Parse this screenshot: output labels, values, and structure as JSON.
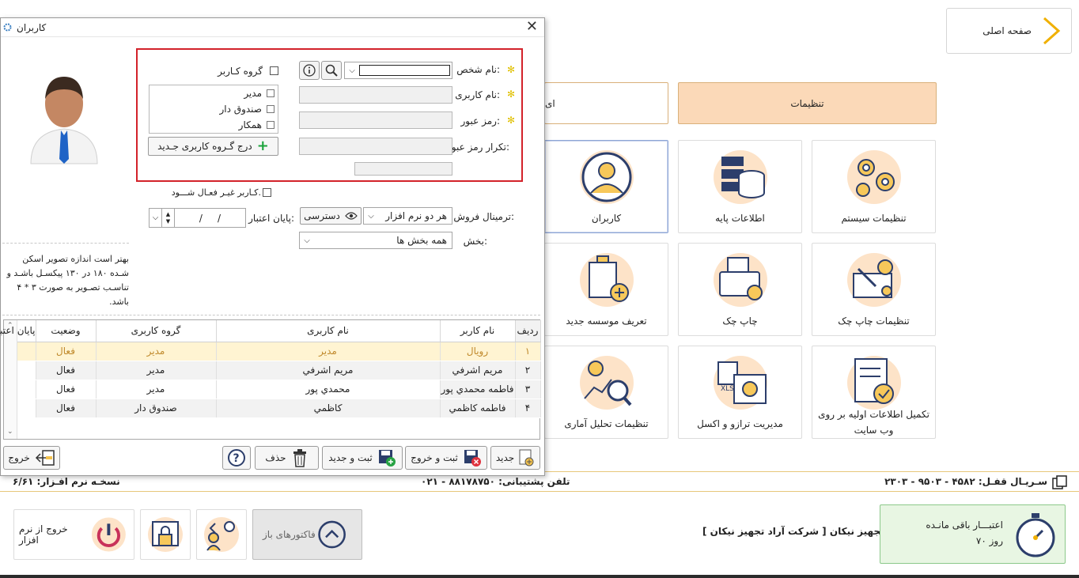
{
  "background": {
    "home_label": "صفحه اصلی",
    "tab_settings": "تنظیمات",
    "tab_other": "ای",
    "tiles": {
      "system_settings": "تنظیمات سیستم",
      "base_info": "اطلاعات پایه",
      "users": "کاربران",
      "cheque_print_settings": "تنظیمات چاپ چک",
      "print_cheque": "چاپ چک",
      "new_company": "تعریف موسسه جدید",
      "complete_info_l1": "تکمیل اطلاعات اولیه بر روی",
      "complete_info_l2": "وب سایت",
      "scale_excel": "مدیریت ترازو و اکسل",
      "stats_settings": "تنظیمات تحلیل آماری"
    },
    "status": {
      "serial": "سـریـال قفـل: ۴۵۸۲ - ۹۵۰۳ - ۲۳۰۳",
      "phone": "تلفن پشتیبانی: ۸۸۱۷۸۷۵۰ - ۰۲۱",
      "version": "نسخـه نرم افـزار: ۶/۶۱"
    },
    "bottom": {
      "exit_label": "خروج از نرم افزار",
      "open_invoices": "فاکتورهای باز",
      "company": "آراد تجهیز نیکان [ شرکت آراد تجهیز نیکان ]",
      "credit_title": "اعتبـــار باقی مانـده",
      "credit_value": "۷۰ روز"
    },
    "colors": {
      "accent_orange": "#fbd9b8",
      "credit_green": "#e8f6e3",
      "red_frame": "#d3222a"
    }
  },
  "dialog": {
    "title": "کاربران",
    "form": {
      "person_name_label": "نام شخص:",
      "username_label": "نام کاربری:",
      "password_label": "رمز عبور:",
      "repeat_password_label": "تکرار رمز عبور:",
      "user_group_label": "گروه کـاربر",
      "groups": [
        "مدیر",
        "صندوق دار",
        "همکار"
      ],
      "add_group_button": "درج گـروه کاربری جـدید",
      "inactive_label": "کـاربر غیـر فعـال شـــود.",
      "terminal_label": "ترمینال فروش:",
      "terminal_value": "هر دو نرم افزار",
      "access_button": "دسترسی",
      "expiry_label": "پایان اعتبار:",
      "expiry_value": "/     /",
      "section_label": "بخش:",
      "section_value": "همه بخش ها"
    },
    "photo_hint": "بهتر است اندازه تصویر اسکن شـده ۱۸۰ در ۱۳۰ پیکسـل باشـد و تناسـب تصـویر به صورت ۳ * ۴ باشد.",
    "table": {
      "headers": {
        "row": "ردیف",
        "name": "نام کاربر",
        "username": "نام کاربری",
        "group": "گروه کاربری",
        "status": "وضعیت",
        "expiry": "پایان اعتبار"
      },
      "rows": [
        {
          "row": "۱",
          "name": "رویال",
          "username": "مدیر",
          "group": "مدیر",
          "status": "فعال",
          "expiry": ""
        },
        {
          "row": "۲",
          "name": "مریم اشرفي",
          "username": "مریم اشرفي",
          "group": "مدیر",
          "status": "فعال",
          "expiry": ""
        },
        {
          "row": "۳",
          "name": "فاطمه محمدي پور",
          "username": "محمدي پور",
          "group": "مدیر",
          "status": "فعال",
          "expiry": ""
        },
        {
          "row": "۴",
          "name": "فاطمه کاظمي",
          "username": "کاظمي",
          "group": "صندوق دار",
          "status": "فعال",
          "expiry": ""
        }
      ]
    },
    "buttons": {
      "new": "جدید",
      "save_exit": "ثبت و خروج",
      "save_new": "ثبت و جدید",
      "delete": "حذف",
      "exit": "خروج"
    }
  }
}
